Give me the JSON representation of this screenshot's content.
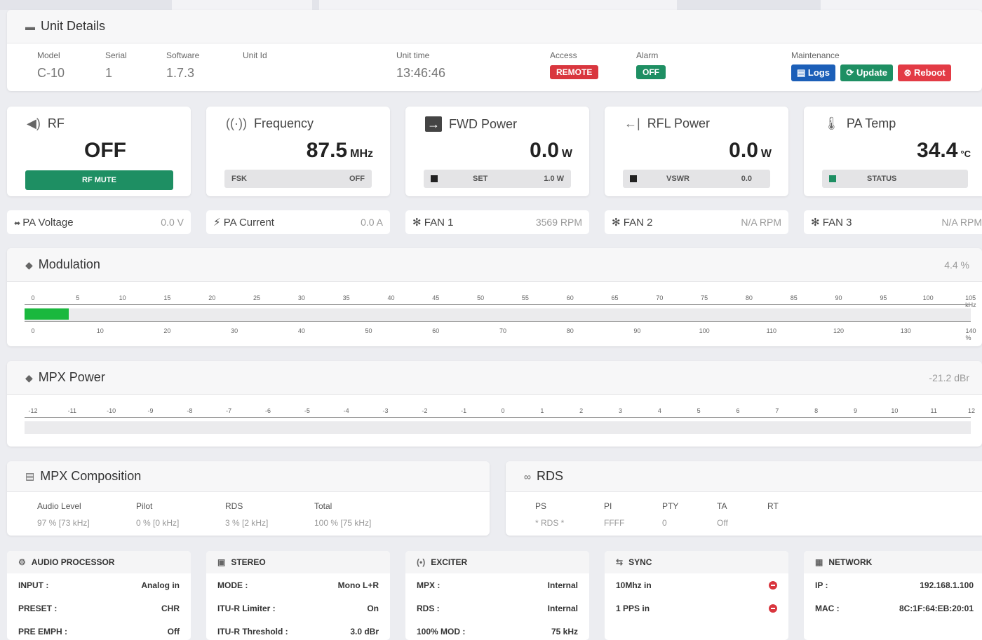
{
  "unit": {
    "title": "Unit Details",
    "model": {
      "label": "Model",
      "value": "C-10"
    },
    "serial": {
      "label": "Serial",
      "value": "1"
    },
    "software": {
      "label": "Software",
      "value": "1.7.3"
    },
    "unit_id": {
      "label": "Unit Id",
      "value": ""
    },
    "unit_time": {
      "label": "Unit time",
      "value": "13:46:46"
    },
    "access": {
      "label": "Access",
      "value": "REMOTE"
    },
    "alarm": {
      "label": "Alarm",
      "value": "OFF"
    },
    "maintenance": {
      "label": "Maintenance",
      "logs": "Logs",
      "update": "Update",
      "reboot": "Reboot"
    }
  },
  "tiles": {
    "rf": {
      "title": "RF",
      "value": "OFF",
      "button": "RF MUTE"
    },
    "frequency": {
      "title": "Frequency",
      "value": "87.5",
      "unit": "MHz",
      "bar_left": "FSK",
      "bar_right": "OFF"
    },
    "fwd": {
      "title": "FWD Power",
      "value": "0.0",
      "unit": "W",
      "bar_mid": "SET",
      "bar_right": "1.0 W"
    },
    "rfl": {
      "title": "RFL Power",
      "value": "0.0",
      "unit": "W",
      "bar_mid": "VSWR",
      "bar_right": "0.0"
    },
    "temp": {
      "title": "PA Temp",
      "value": "34.4",
      "unit": "°C",
      "bar_mid": "STATUS"
    }
  },
  "minis": {
    "pa_voltage": {
      "label": "PA Voltage",
      "value": "0.0 V"
    },
    "pa_current": {
      "label": "PA Current",
      "value": "0.0 A"
    },
    "fan1": {
      "label": "FAN 1",
      "value": "3569 RPM"
    },
    "fan2": {
      "label": "FAN 2",
      "value": "N/A RPM"
    },
    "fan3": {
      "label": "FAN 3",
      "value": "N/A RPM"
    }
  },
  "modulation": {
    "title": "Modulation",
    "value": "4.4 %",
    "level_percent": 4.4,
    "top_scale": [
      "0",
      "5",
      "10",
      "15",
      "20",
      "25",
      "30",
      "35",
      "40",
      "45",
      "50",
      "55",
      "60",
      "65",
      "70",
      "75",
      "80",
      "85",
      "90",
      "95",
      "100",
      "105 kHz"
    ],
    "bottom_scale": [
      "0",
      "10",
      "20",
      "30",
      "40",
      "50",
      "60",
      "70",
      "80",
      "90",
      "100",
      "110",
      "120",
      "130",
      "140 %"
    ]
  },
  "mpx_power": {
    "title": "MPX Power",
    "value": "-21.2 dBr",
    "scale": [
      "-12",
      "-11",
      "-10",
      "-9",
      "-8",
      "-7",
      "-6",
      "-5",
      "-4",
      "-3",
      "-2",
      "-1",
      "0",
      "1",
      "2",
      "3",
      "4",
      "5",
      "6",
      "7",
      "8",
      "9",
      "10",
      "11",
      "12"
    ]
  },
  "mpx_comp": {
    "title": "MPX Composition",
    "items": [
      {
        "label": "Audio Level",
        "value": "97 %  [73 kHz]"
      },
      {
        "label": "Pilot",
        "value": "0 %  [0 kHz]"
      },
      {
        "label": "RDS",
        "value": "3 %  [2 kHz]"
      },
      {
        "label": "Total",
        "value": "100 %  [75 kHz]"
      }
    ]
  },
  "rds": {
    "title": "RDS",
    "items": [
      {
        "label": "PS",
        "value": "* RDS *"
      },
      {
        "label": "PI",
        "value": "FFFF"
      },
      {
        "label": "PTY",
        "value": "0"
      },
      {
        "label": "TA",
        "value": "Off"
      },
      {
        "label": "RT",
        "value": ""
      }
    ]
  },
  "audio": {
    "title": "AUDIO PROCESSOR",
    "rows": [
      {
        "k": "INPUT :",
        "v": "Analog in"
      },
      {
        "k": "PRESET :",
        "v": "CHR"
      },
      {
        "k": "PRE EMPH :",
        "v": "Off"
      }
    ]
  },
  "stereo": {
    "title": "STEREO",
    "rows": [
      {
        "k": "MODE :",
        "v": "Mono L+R"
      },
      {
        "k": "ITU-R Limiter :",
        "v": "On"
      },
      {
        "k": "ITU-R Threshold :",
        "v": "3.0 dBr"
      }
    ]
  },
  "exciter": {
    "title": "EXCITER",
    "rows": [
      {
        "k": "MPX :",
        "v": "Internal"
      },
      {
        "k": "RDS :",
        "v": "Internal"
      },
      {
        "k": "100% MOD :",
        "v": "75 kHz"
      }
    ]
  },
  "sync": {
    "title": "SYNC",
    "rows": [
      {
        "k": "10Mhz in"
      },
      {
        "k": "1 PPS in"
      }
    ]
  },
  "network": {
    "title": "NETWORK",
    "rows": [
      {
        "k": "IP :",
        "v": "192.168.1.100"
      },
      {
        "k": "MAC :",
        "v": "8C:1F:64:EB:20:01"
      }
    ]
  },
  "colors": {
    "green": "#1e8f63",
    "red": "#d9363e",
    "blue": "#1c5fb8",
    "mod_fill": "#1ab83e"
  }
}
